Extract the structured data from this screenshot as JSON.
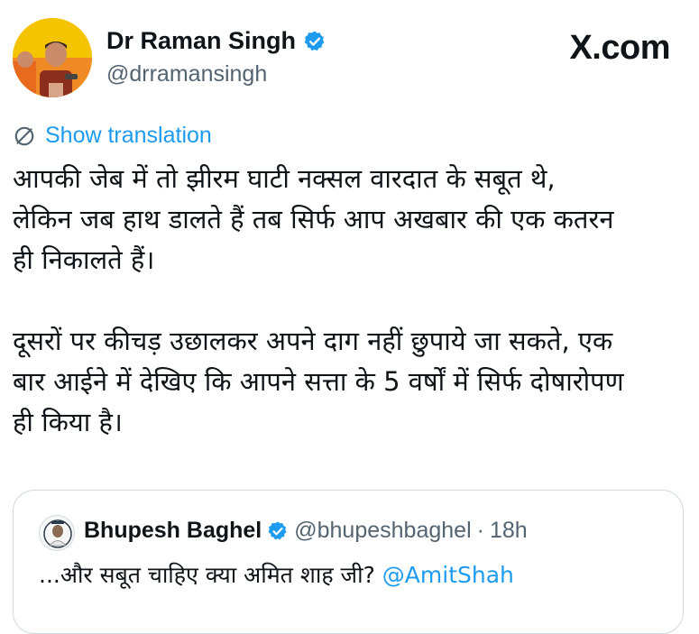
{
  "author": {
    "name": "Dr Raman Singh",
    "handle": "@drramansingh",
    "verified": true
  },
  "brand": "X.com",
  "translation": {
    "label": "Show translation",
    "icon": "globe-icon"
  },
  "tweet": {
    "paragraphs": [
      "आपकी जेब में तो झीरम घाटी नक्सल वारदात के सबूत थे,\nलेकिन जब हाथ डालते हैं तब सिर्फ आप अखबार की एक कतरन\nही निकालते हैं।",
      "दूसरों पर कीचड़ उछालकर अपने दाग नहीं छुपाये जा सकते, एक\nबार आईने में देखिए कि आपने सत्ता के 5 वर्षों में सिर्फ दोषारोपण\nही किया है।"
    ]
  },
  "quoted_tweet": {
    "name": "Bhupesh Baghel",
    "handle": "@bhupeshbaghel",
    "separator": "·",
    "time": "18h",
    "text": "...और सबूत चाहिए क्या अमित शाह जी?",
    "mention": "@AmitShah",
    "verified": true
  },
  "colors": {
    "link": "#1d9bf0",
    "verified_badge": "#1d9bf0",
    "secondary_text": "#536471",
    "text": "#0f1419",
    "border": "#cfd9de"
  }
}
